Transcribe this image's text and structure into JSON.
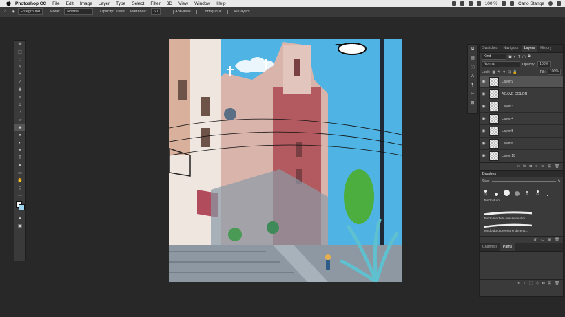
{
  "menubar": {
    "app_name": "Photoshop CC",
    "items": [
      "File",
      "Edit",
      "Image",
      "Layer",
      "Type",
      "Select",
      "Filter",
      "3D",
      "View",
      "Window",
      "Help"
    ],
    "battery": "100 %",
    "user": "Carlo Stanga"
  },
  "options": {
    "fill_source": "Foreground",
    "mode_label": "Mode:",
    "mode_value": "Normal",
    "opacity_label": "Opacity:",
    "opacity_value": "100%",
    "tolerance_label": "Tolerance:",
    "tolerance_value": "60",
    "anti_alias": "Anti-alias",
    "contiguous": "Contiguous",
    "all_layers": "All Layers"
  },
  "layers_panel": {
    "tabs": [
      "Swatches",
      "Navigator",
      "Layers",
      "History"
    ],
    "active_tab": "Layers",
    "filter_kind": "Kind",
    "blend_mode": "Normal",
    "opacity_label": "Opacity:",
    "opacity_value": "100%",
    "lock_label": "Lock:",
    "fill_label": "Fill:",
    "fill_value": "100%",
    "layers": [
      {
        "name": "Layer 9",
        "selected": true
      },
      {
        "name": "AGAVE COLOR",
        "selected": false
      },
      {
        "name": "Layer 3",
        "selected": false
      },
      {
        "name": "Layer 4",
        "selected": false
      },
      {
        "name": "Layer 5",
        "selected": false
      },
      {
        "name": "Layer 6",
        "selected": false
      },
      {
        "name": "Layer 18",
        "selected": false
      }
    ]
  },
  "brushes_panel": {
    "title": "Brushes",
    "size_label": "Size:",
    "brush_sizes": [
      "25",
      "",
      "",
      "",
      "5",
      "14",
      ""
    ],
    "presets": [
      "Tondo duro",
      "Tondo morbido pressione dim...",
      "Tondo duro pressione dimens..."
    ]
  },
  "channels_panel": {
    "tabs": [
      "Channels",
      "Paths"
    ],
    "active_tab": "Paths"
  },
  "colors": {
    "sky": "#4fb3e3",
    "church_pink": "#c98c84",
    "church_red": "#b25a5f",
    "wall_grey": "#8a9aa6",
    "agave": "#5fc0cf"
  }
}
